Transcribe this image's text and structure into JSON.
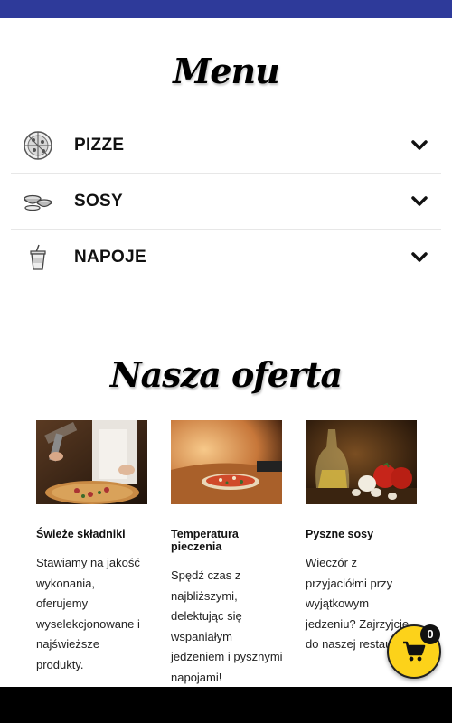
{
  "menu": {
    "title": "Menu",
    "items": [
      {
        "label": "PIZZE",
        "icon": "pizza-icon"
      },
      {
        "label": "SOSY",
        "icon": "sauce-bowls-icon"
      },
      {
        "label": "NAPOJE",
        "icon": "drink-cup-icon"
      }
    ],
    "expand_icon": "chevron-down-icon"
  },
  "offer": {
    "title": "Nasza oferta",
    "cards": [
      {
        "title": "Świeże składniki",
        "text": "Stawiamy na jakość wykonania, oferujemy wyselekcjonowane i najświeższe produkty.",
        "image": "chef-pizza-photo"
      },
      {
        "title": "Temperatura pieczenia",
        "text": "Spędź czas z najbliższymi, delektując się wspaniałym jedzeniem i pysznymi napojami!",
        "image": "pizza-oven-photo"
      },
      {
        "title": "Pyszne sosy",
        "text": "Wieczór z przyjaciółmi przy wyjątkowym jedzeniu? Zajrzyjcie do naszej restauracji.",
        "image": "oil-garlic-tomato-photo"
      }
    ]
  },
  "cart": {
    "count": "0",
    "icon": "shopping-cart-icon"
  },
  "colors": {
    "top_bar": "#2e3a9a",
    "cart_button": "#fcd21a",
    "badge": "#111111"
  }
}
